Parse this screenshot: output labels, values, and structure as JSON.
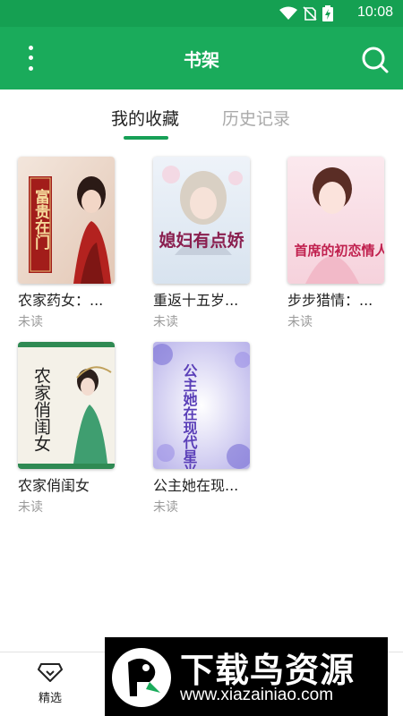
{
  "status_bar": {
    "time": "10:08",
    "icons": [
      "wifi-icon",
      "no-sim-icon",
      "battery-charging-icon"
    ]
  },
  "header": {
    "title": "书架",
    "menu_icon": "more-vertical-icon",
    "search_icon": "search-icon"
  },
  "tabs": [
    {
      "label": "我的收藏",
      "active": true
    },
    {
      "label": "历史记录",
      "active": false
    }
  ],
  "books": [
    {
      "title": "农家药女：...",
      "status": "未读",
      "cover_text": "富贵在门"
    },
    {
      "title": "重返十五岁...",
      "status": "未读",
      "cover_text": "媳妇有点娇"
    },
    {
      "title": "步步猎情：...",
      "status": "未读",
      "cover_text": "首席的初恋情人"
    },
    {
      "title": "农家俏闺女",
      "status": "未读",
      "cover_text": "农家俏闺女"
    },
    {
      "title": "公主她在现...",
      "status": "未读",
      "cover_text": "公主她在现代星光璀璨"
    }
  ],
  "bottom_nav": {
    "featured_label": "精选",
    "featured_icon": "diamond-icon"
  },
  "watermark": {
    "title": "下载鸟资源",
    "url": "www.xiazainiao.com"
  },
  "colors": {
    "primary": "#1aab5b",
    "status_bar": "#15a052",
    "indicator": "#17a057"
  }
}
